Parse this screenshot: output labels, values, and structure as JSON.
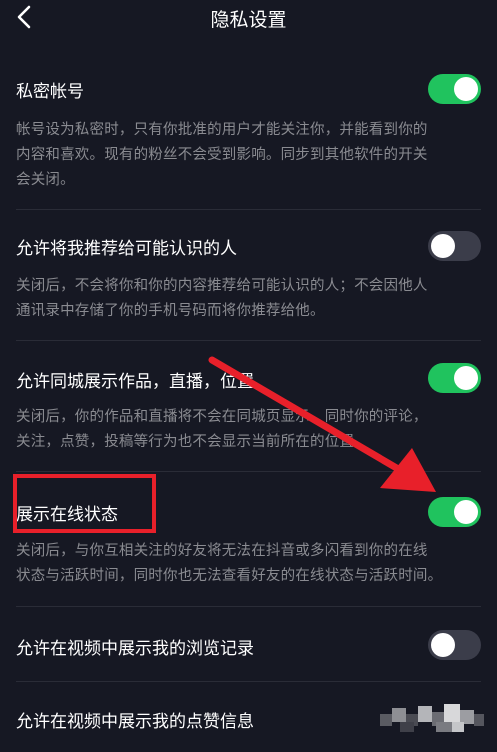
{
  "header": {
    "title": "隐私设置"
  },
  "settings": [
    {
      "title": "私密帐号",
      "desc_lines": [
        "帐号设为私密时，只有你批准的用户才能关注你，并能看到你的",
        "内容和喜欢。现有的粉丝不会受到影响。同步到其他软件的开关",
        "会关闭。"
      ],
      "enabled": true
    },
    {
      "title": "允许将我推荐给可能认识的人",
      "desc_lines": [
        "关闭后，不会将你和你的内容推荐给可能认识的人；不会因他人",
        "通讯录中存储了你的手机号码而将你推荐给他。"
      ],
      "enabled": false
    },
    {
      "title": "允许同城展示作品，直播，位置",
      "desc_lines": [
        "关闭后，你的作品和直播将不会在同城页显示，同时你的评论，",
        "关注，点赞，投稿等行为也不会显示当前所在的位置。"
      ],
      "enabled": true
    },
    {
      "title": "展示在线状态",
      "desc_lines": [
        "关闭后，与你互相关注的好友将无法在抖音或多闪看到你的在线",
        "状态与活跃时间，同时你也无法查看好友的在线状态与活跃时间。"
      ],
      "enabled": true
    },
    {
      "title": "允许在视频中展示我的浏览记录",
      "enabled": false
    },
    {
      "title": "允许在视频中展示我的点赞信息"
    }
  ],
  "colors": {
    "background": "#161823",
    "toggle_on": "#20c35e",
    "toggle_off": "#3b3d4a",
    "description": "#8a8b91",
    "annotation": "#e8202a"
  },
  "icons": {
    "back": "chevron-left-icon"
  }
}
